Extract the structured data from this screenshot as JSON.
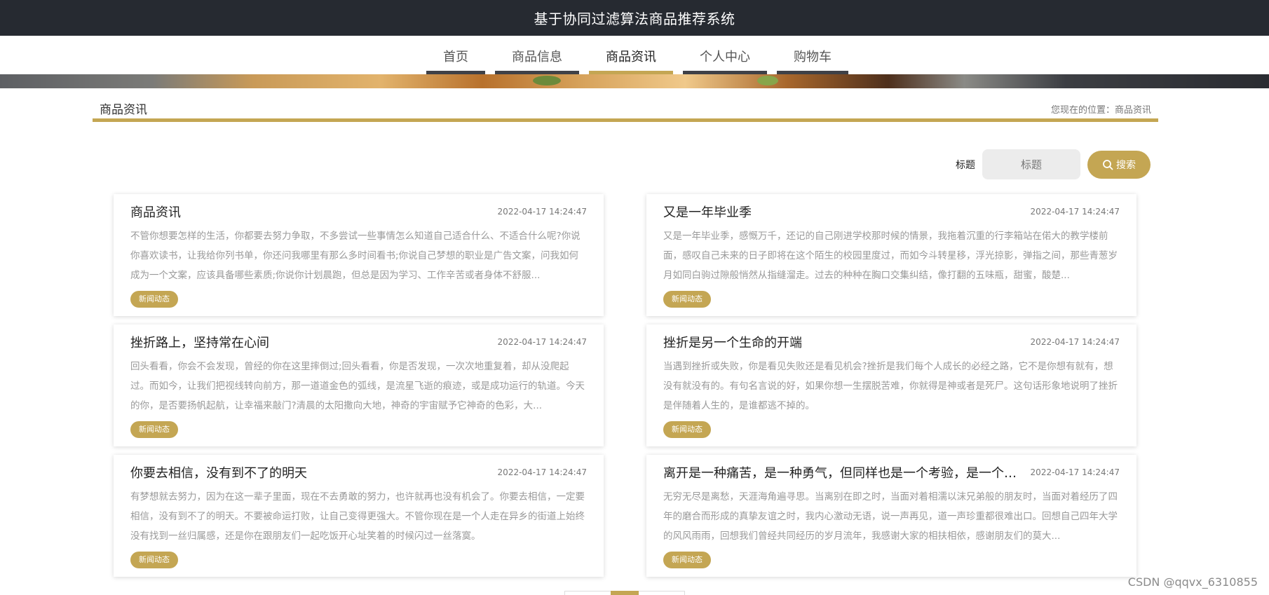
{
  "site": {
    "title": "基于协同过滤算法商品推荐系统"
  },
  "nav": {
    "items": [
      {
        "label": "首页",
        "active": false
      },
      {
        "label": "商品信息",
        "active": false
      },
      {
        "label": "商品资讯",
        "active": true
      },
      {
        "label": "个人中心",
        "active": false
      },
      {
        "label": "购物车",
        "active": false
      }
    ]
  },
  "section": {
    "title": "商品资讯",
    "location": "您现在的位置：商品资讯"
  },
  "search": {
    "label": "标题",
    "placeholder": "标题",
    "button_label": "搜索"
  },
  "news": [
    {
      "title": "商品资讯",
      "time": "2022-04-17 14:24:47",
      "tag": "新闻动态",
      "summary": "不管你想要怎样的生活，你都要去努力争取，不多尝试一些事情怎么知道自己适合什么、不适合什么呢?你说你喜欢读书，让我给你列书单，你还问我哪里有那么多时间看书;你说自己梦想的职业是广告文案，问我如何成为一个文案，应该具备哪些素质;你说你计划晨跑，但总是因为学习、工作辛苦或者身体不舒服..."
    },
    {
      "title": "又是一年毕业季",
      "time": "2022-04-17 14:24:47",
      "tag": "新闻动态",
      "summary": "又是一年毕业季，感慨万千，还记的自己刚进学校那时候的情景，我拖着沉重的行李箱站在偌大的教学楼前面，感叹自己未来的日子即将在这个陌生的校园里度过，而如今斗转星移，浮光掠影，弹指之间，那些青葱岁月如同白驹过隙般悄然从指缝溜走。过去的种种在胸口交集纠结，像打翻的五味瓶，甜蜜，酸楚..."
    },
    {
      "title": "挫折路上，坚持常在心间",
      "time": "2022-04-17 14:24:47",
      "tag": "新闻动态",
      "summary": "回头看看，你会不会发现，曾经的你在这里摔倒过;回头看看，你是否发现，一次次地重复着，却从没爬起过。而如今，让我们把视线转向前方，那一道道金色的弧线，是流星飞逝的痕迹，或是成功运行的轨道。今天的你，是否要扬帆起航，让幸福来敲门?清晨的太阳撒向大地，神奇的宇宙赋予它神奇的色彩，大..."
    },
    {
      "title": "挫折是另一个生命的开端",
      "time": "2022-04-17 14:24:47",
      "tag": "新闻动态",
      "summary": "当遇到挫折或失败，你是看见失败还是看见机会?挫折是我们每个人成长的必经之路，它不是你想有就有，想没有就没有的。有句名言说的好，如果你想一生摆脱苦难，你就得是神或者是死尸。这句话形象地说明了挫折是伴随着人生的，是谁都逃不掉的。"
    },
    {
      "title": "你要去相信，没有到不了的明天",
      "time": "2022-04-17 14:24:47",
      "tag": "新闻动态",
      "summary": "有梦想就去努力，因为在这一辈子里面，现在不去勇敢的努力，也许就再也没有机会了。你要去相信，一定要相信，没有到不了的明天。不要被命运打败，让自己变得更强大。不管你现在是一个人走在异乡的街道上始终没有找到一丝归属感，还是你在跟朋友们一起吃饭开心址笑着的时候闪过一丝落寞。"
    },
    {
      "title": "离开是一种痛苦，是一种勇气，但同样也是一个考验，是一个新...",
      "time": "2022-04-17 14:24:47",
      "tag": "新闻动态",
      "summary": "无穷无尽是离愁，天涯海角遍寻思。当离别在即之时，当面对着相濡以沫兄弟般的朋友时，当面对着经历了四年的磨合而形成的真挚友谊之时，我内心激动无语，说一声再见，道一声珍重都很难出口。回想自己四年大学的风风雨雨，回想我们曾经共同经历的岁月流年，我感谢大家的相扶相依，感谢朋友们的莫大..."
    }
  ],
  "watermark": "CSDN @qqvx_6310855"
}
